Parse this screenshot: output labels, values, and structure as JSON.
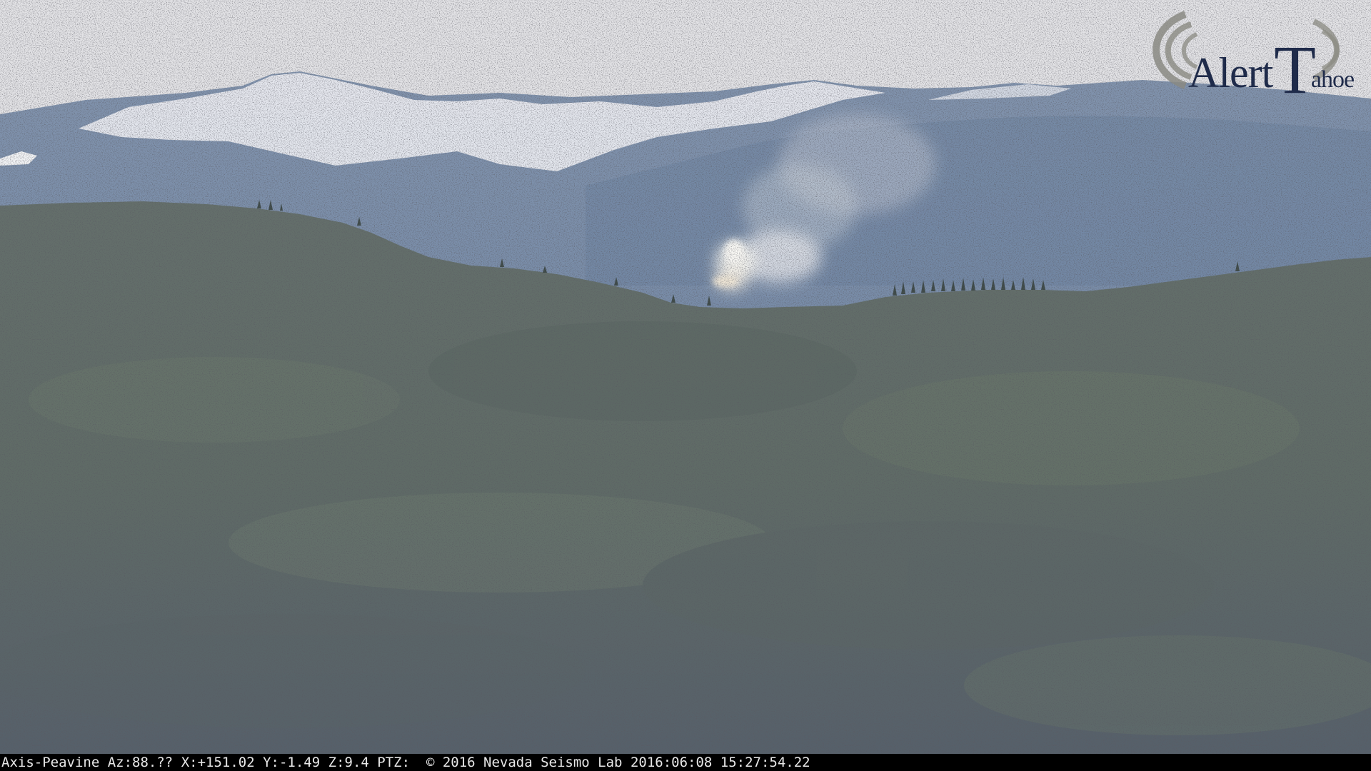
{
  "camera": {
    "logo_name": "Alert",
    "logo_letter": "T",
    "logo_rest": "ahoe"
  },
  "overlay": {
    "camera_name": "Axis-Peavine",
    "azimuth": "Az:88.??",
    "x_coord": "X:+151.02",
    "y_coord": "Y:-1.49",
    "zoom": "Z:9.4",
    "ptz": "PTZ:",
    "copyright": "© 2016 Nevada Seismo Lab",
    "timestamp": "2016:06:08 15:27:54.22"
  },
  "colors": {
    "sky": "#e3e3e6",
    "snow": "#f2f3f5",
    "far_range": "#7f93ad",
    "near_hill": "#5e6a68",
    "smoke": "#f4f2ec",
    "status_bg": "#000000",
    "status_text": "#e8e8e8"
  }
}
